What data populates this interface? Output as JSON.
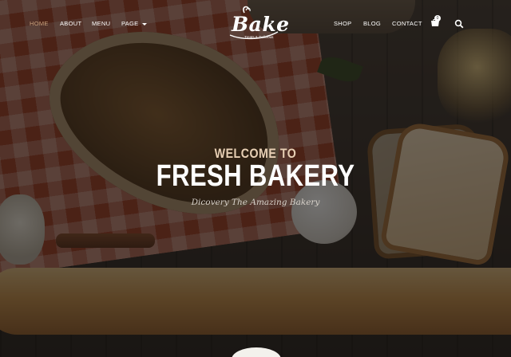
{
  "nav": {
    "items": [
      {
        "label": "HOME",
        "active": true
      },
      {
        "label": "ABOUT"
      },
      {
        "label": "MENU"
      },
      {
        "label": "PAGE"
      },
      {
        "label": "SHOP"
      },
      {
        "label": "BLOG"
      },
      {
        "label": "CONTACT"
      }
    ],
    "cart_count": "0",
    "accent_color": "#c9a27e"
  },
  "logo": {
    "word": "Bake",
    "subtitle": "Treats & Delicious"
  },
  "hero": {
    "welcome": "WELCOME TO",
    "headline": "FRESH BAKERY",
    "tagline": "Dicovery The Amazing Bakery"
  },
  "icons": [
    "cart-icon",
    "search-icon",
    "caret-down-icon"
  ]
}
